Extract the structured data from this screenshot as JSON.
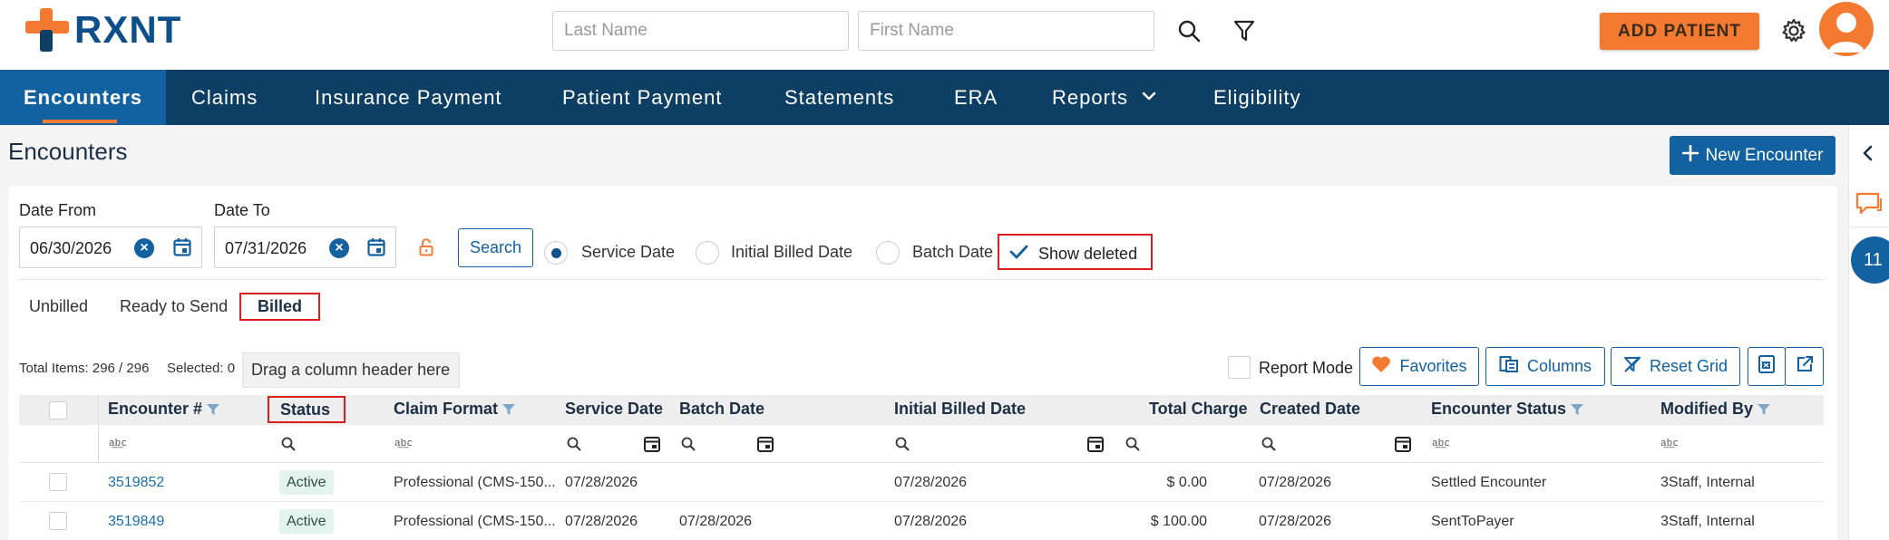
{
  "app": {
    "logo_text": "RXNT"
  },
  "header": {
    "last_name_placeholder": "Last Name",
    "first_name_placeholder": "First Name",
    "add_patient_label": "ADD PATIENT"
  },
  "nav": {
    "items": [
      {
        "label": "Encounters"
      },
      {
        "label": "Claims"
      },
      {
        "label": "Insurance Payment"
      },
      {
        "label": "Patient Payment"
      },
      {
        "label": "Statements"
      },
      {
        "label": "ERA"
      },
      {
        "label": "Reports"
      },
      {
        "label": "Eligibility"
      }
    ]
  },
  "page": {
    "title": "Encounters",
    "new_encounter_label": "New Encounter"
  },
  "filters": {
    "date_from_label": "Date From",
    "date_from_value": "06/30/2026",
    "date_to_label": "Date To",
    "date_to_value": "07/31/2026",
    "search_label": "Search",
    "radio_options": [
      "Service Date",
      "Initial Billed Date",
      "Batch Date"
    ],
    "selected_radio": "Service Date",
    "show_deleted_label": "Show deleted",
    "show_deleted_checked": true
  },
  "tabs": [
    {
      "label": "Unbilled"
    },
    {
      "label": "Ready to Send"
    },
    {
      "label": "Billed"
    }
  ],
  "toolbar": {
    "total_items": "Total Items: 296 / 296",
    "selected": "Selected: 0",
    "drag_hint": "Drag a column header here",
    "report_mode_label": "Report Mode",
    "favorites_label": "Favorites",
    "columns_label": "Columns",
    "reset_grid_label": "Reset Grid"
  },
  "grid": {
    "columns": [
      "Encounter #",
      "Status",
      "Claim Format",
      "Service Date",
      "Batch Date",
      "Initial Billed Date",
      "Total Charge",
      "Created Date",
      "Encounter Status",
      "Modified By"
    ],
    "rows": [
      {
        "encounter": "3519852",
        "status": "Active",
        "claim_format": "Professional (CMS-150...",
        "service_date": "07/28/2026",
        "batch_date": "",
        "initial_billed_date": "07/28/2026",
        "total_charge": "$ 0.00",
        "created_date": "07/28/2026",
        "encounter_status": "Settled Encounter",
        "modified_by": "3Staff, Internal"
      },
      {
        "encounter": "3519849",
        "status": "Active",
        "claim_format": "Professional (CMS-150...",
        "service_date": "07/28/2026",
        "batch_date": "07/28/2026",
        "initial_billed_date": "07/28/2026",
        "total_charge": "$ 100.00",
        "created_date": "07/28/2026",
        "encounter_status": "SentToPayer",
        "modified_by": "3Staff, Internal"
      }
    ]
  },
  "rail": {
    "badge_count": "11"
  },
  "colors": {
    "navy": "#0d3e63",
    "primary_blue": "#1261a0",
    "brand_orange": "#f47a31",
    "highlight_red": "#d91f1f",
    "status_bg": "#e3f3ee"
  },
  "icons": [
    "search-icon",
    "filter-icon",
    "gear-icon",
    "user-avatar-icon",
    "plus-icon",
    "clear-icon",
    "calendar-icon",
    "unlock-icon",
    "check-icon",
    "heart-icon",
    "columns-icon",
    "reset-filter-icon",
    "export-excel-icon",
    "share-icon",
    "chevron-left-icon",
    "chat-icon",
    "chevron-down-icon"
  ]
}
